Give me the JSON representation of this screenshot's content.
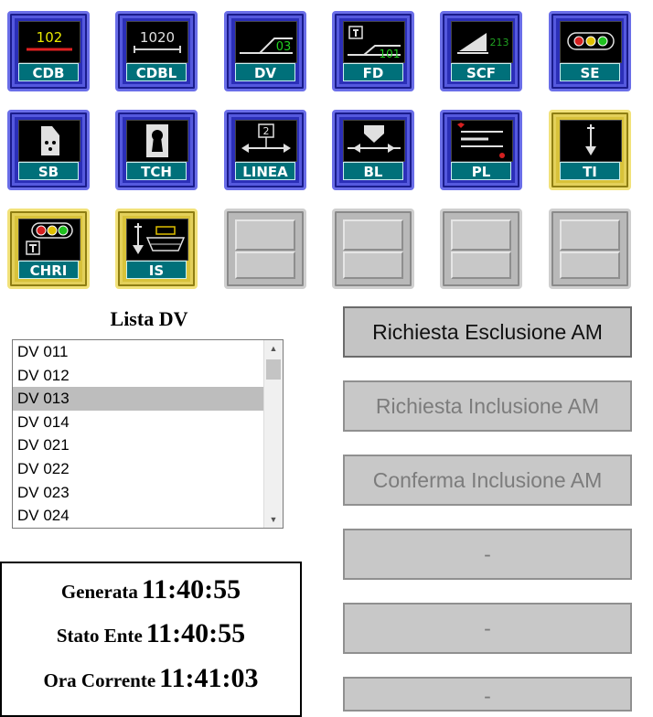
{
  "tiles": [
    {
      "label": "CDB",
      "style": "blue",
      "face_text": "102"
    },
    {
      "label": "CDBL",
      "style": "blue",
      "face_text": "1020"
    },
    {
      "label": "DV",
      "style": "blue",
      "face_text": "03"
    },
    {
      "label": "FD",
      "style": "blue",
      "face_text": "101"
    },
    {
      "label": "SCF",
      "style": "blue",
      "face_text": "213"
    },
    {
      "label": "SE",
      "style": "blue"
    },
    {
      "label": "SB",
      "style": "blue"
    },
    {
      "label": "TCH",
      "style": "blue"
    },
    {
      "label": "LINEA",
      "style": "blue",
      "face_text": "2"
    },
    {
      "label": "BL",
      "style": "blue"
    },
    {
      "label": "PL",
      "style": "blue"
    },
    {
      "label": "TI",
      "style": "yellow"
    },
    {
      "label": "CHRI",
      "style": "yellow"
    },
    {
      "label": "IS",
      "style": "yellow"
    }
  ],
  "colors": {
    "tile_blue": "#2b2fb8",
    "tile_yellow": "#d8c23a",
    "label_teal": "#00707a",
    "signal_red": "#d42020",
    "signal_yellow": "#e0c000",
    "signal_green": "#20c020"
  },
  "list": {
    "title": "Lista DV",
    "items": [
      "DV 011",
      "DV 012",
      "DV 013",
      "DV 014",
      "DV 021",
      "DV 022",
      "DV 023",
      "DV 024"
    ],
    "selected": "DV 013"
  },
  "actions": [
    {
      "label": "Richiesta Esclusione AM",
      "enabled": true
    },
    {
      "label": "Richiesta Inclusione AM",
      "enabled": false
    },
    {
      "label": "Conferma Inclusione AM",
      "enabled": false
    },
    {
      "label": "-",
      "enabled": false
    },
    {
      "label": "-",
      "enabled": false
    },
    {
      "label": "-",
      "enabled": false
    }
  ],
  "times": {
    "generata_label": "Generata",
    "generata": "11:40:55",
    "stato_label": "Stato Ente",
    "stato": "11:40:55",
    "corrente_label": "Ora Corrente",
    "corrente": "11:41:03"
  }
}
